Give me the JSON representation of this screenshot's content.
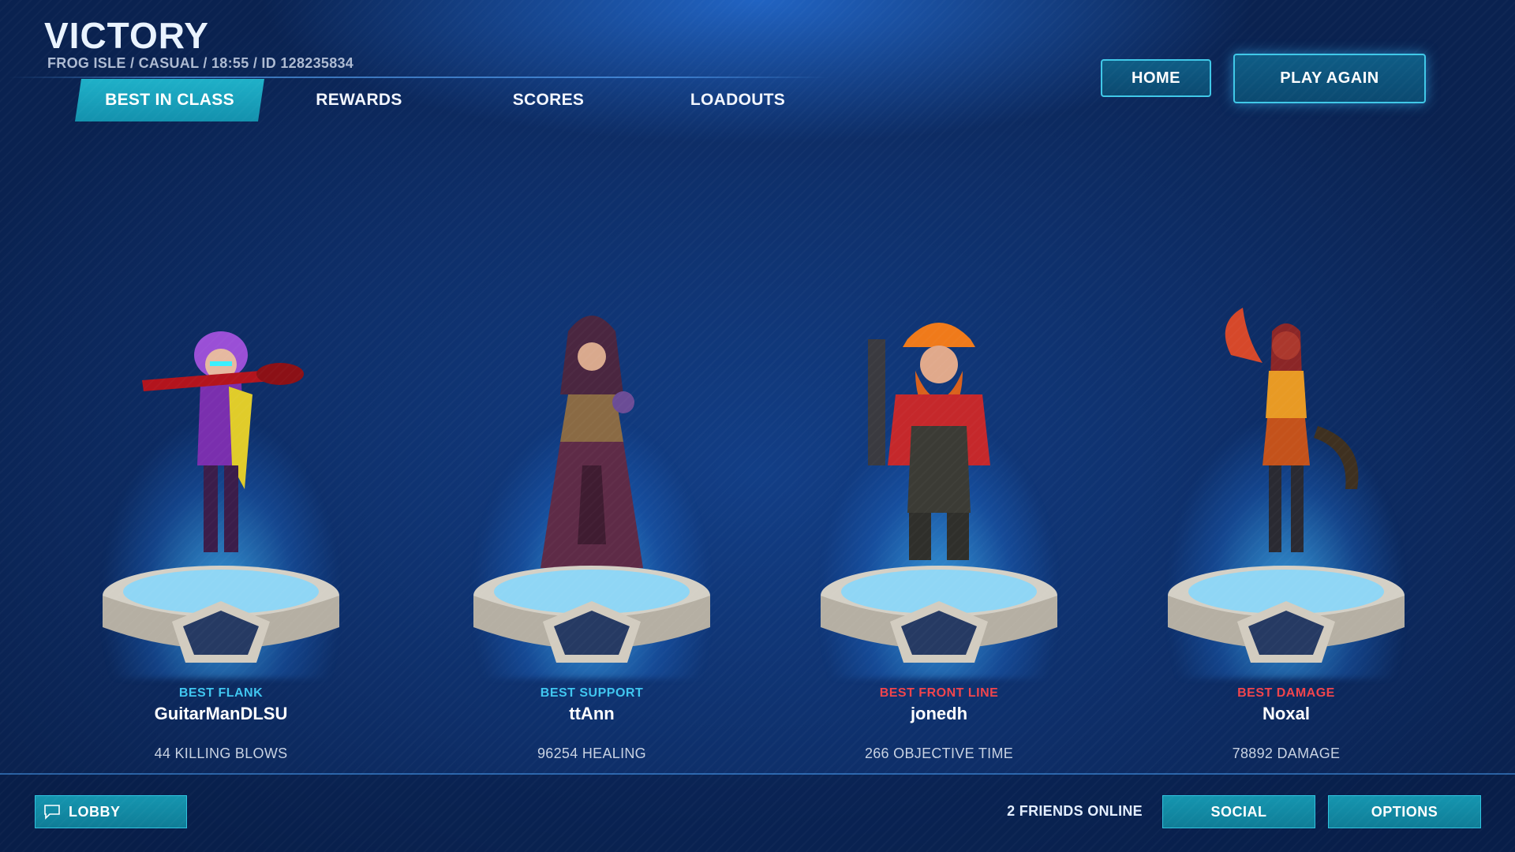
{
  "header": {
    "title": "VICTORY",
    "subtitle": "FROG ISLE  /  CASUAL  /  18:55  /  ID 128235834"
  },
  "tabs": [
    {
      "label": "BEST IN CLASS",
      "active": true
    },
    {
      "label": "REWARDS",
      "active": false
    },
    {
      "label": "SCORES",
      "active": false
    },
    {
      "label": "LOADOUTS",
      "active": false
    }
  ],
  "buttons": {
    "home": "HOME",
    "play_again": "PLAY AGAIN"
  },
  "champions": [
    {
      "award": "BEST FLANK",
      "award_color": "#3fc6f0",
      "player": "GuitarManDLSU",
      "stat": "44 KILLING BLOWS"
    },
    {
      "award": "BEST SUPPORT",
      "award_color": "#3fc6f0",
      "player": "ttAnn",
      "stat": "96254 HEALING"
    },
    {
      "award": "BEST FRONT LINE",
      "award_color": "#f0444c",
      "player": "jonedh",
      "stat": "266 OBJECTIVE TIME"
    },
    {
      "award": "BEST DAMAGE",
      "award_color": "#f0444c",
      "player": "Noxal",
      "stat": "78892 DAMAGE"
    }
  ],
  "footer": {
    "lobby": "LOBBY",
    "friends_online": "2 FRIENDS ONLINE",
    "social": "SOCIAL",
    "options": "OPTIONS"
  },
  "icons": {
    "lobby": "chat-bubble-icon"
  }
}
